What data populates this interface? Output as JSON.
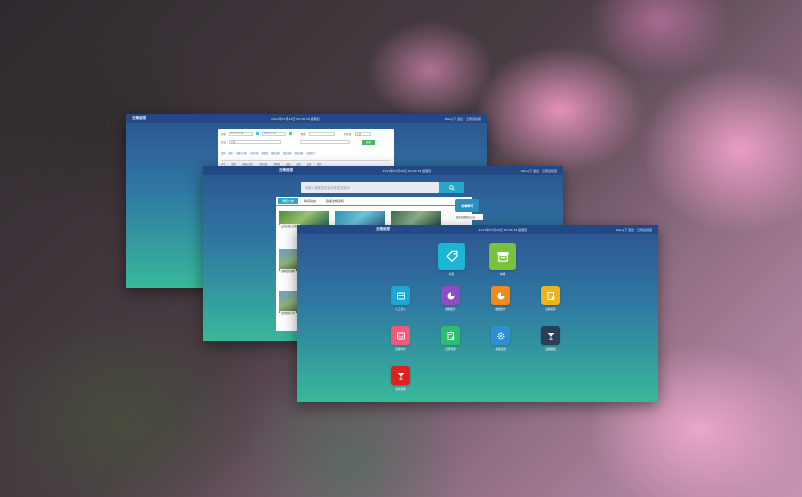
{
  "windows": {
    "w1": {
      "title": "云南运煤",
      "datetime": "2021年07月29日 09:36:38 星期四",
      "user": "Wang下 退出 · 云南运煤首",
      "form": {
        "date_label": "日期",
        "date_from": "2021-07-01",
        "date_to": "2021-07-31",
        "type_label": "种类",
        "status_label": "状态/批",
        "status_value": "全部",
        "area_label": "区域",
        "area_value": "全部",
        "search_label": "搜索"
      },
      "quick_links": [
        "品种",
        "煤种",
        "已确认车数",
        "已发车数",
        "预配数",
        "煤炭运输",
        "煤炭运输",
        "煤炭运输",
        "运量统计"
      ],
      "tabs": [
        "序号",
        "煤种",
        "已确认车数",
        "已发车数",
        "预配数",
        "运量",
        "运量",
        "运量",
        "操作"
      ]
    },
    "w2": {
      "title": "云南运煤",
      "datetime": "2021年07月29日 09:36:38 星期四",
      "user": "Wang下 退出 · 云南运煤首",
      "search_placeholder": "请输入搜索的信息名称或关键词",
      "tabs": [
        "通知公告",
        "新闻动态",
        "政策法规资料"
      ],
      "captions": [
        "云南运煤公司发布",
        "运输情况通报",
        "运煤煤炭公司"
      ],
      "badge_text": "运输情况",
      "badge_caption": "煤炭运输情况公告"
    },
    "w3": {
      "title": "云南运煤",
      "datetime": "2021年07月29日 09:36:38 星期四",
      "user": "Wang下 退出 · 云南运煤首",
      "apps": [
        {
          "label": "标签",
          "color": "#1bb6d6",
          "icon": "tag-icon"
        },
        {
          "label": "车辆",
          "color": "#7ac23d",
          "icon": "truck-icon"
        },
        {
          "label": "人工录入",
          "color": "#1aa8d8",
          "icon": "card-icon"
        },
        {
          "label": "数据统计",
          "color": "#8e4bc4",
          "icon": "pie-chart-icon"
        },
        {
          "label": "数据统计",
          "color": "#f08a1c",
          "icon": "pie-chart-icon"
        },
        {
          "label": "运输管理",
          "color": "#f0b21c",
          "icon": "document-icon"
        },
        {
          "label": "运输单位",
          "color": "#ef5b78",
          "icon": "inbox-icon"
        },
        {
          "label": "结算管理",
          "color": "#2cbf6b",
          "icon": "document-check-icon"
        },
        {
          "label": "系统设置",
          "color": "#2d8fd6",
          "icon": "gear-icon"
        },
        {
          "label": "运输数据",
          "color": "#2a3e57",
          "icon": "cocktail-icon"
        },
        {
          "label": "酒水管理",
          "color": "#e0201c",
          "icon": "cocktail-icon"
        }
      ]
    }
  }
}
